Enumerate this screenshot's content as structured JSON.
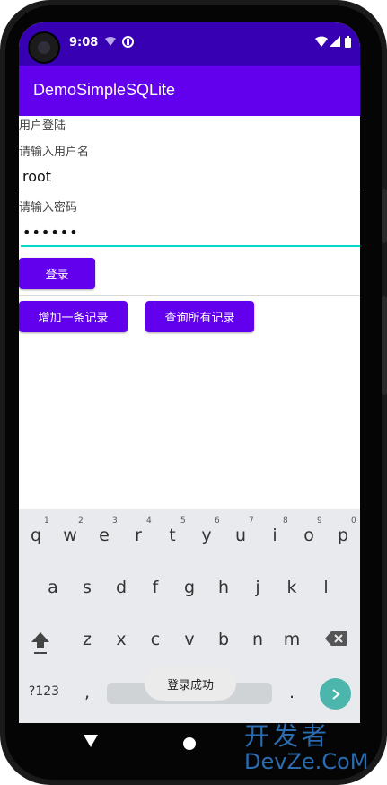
{
  "status_bar": {
    "time": "9:08"
  },
  "app_bar": {
    "title": "DemoSimpleSQLite"
  },
  "login": {
    "header": "用户登陆",
    "username_label": "请输入用户名",
    "username_value": "root",
    "password_label": "请输入密码",
    "password_value": "••••••",
    "login_button": "登录"
  },
  "actions": {
    "add_record": "增加一条记录",
    "query_all": "查询所有记录"
  },
  "keyboard": {
    "row1": [
      "q",
      "w",
      "e",
      "r",
      "t",
      "y",
      "u",
      "i",
      "o",
      "p"
    ],
    "row1_hints": [
      "1",
      "2",
      "3",
      "4",
      "5",
      "6",
      "7",
      "8",
      "9",
      "0"
    ],
    "row2": [
      "a",
      "s",
      "d",
      "f",
      "g",
      "h",
      "j",
      "k",
      "l"
    ],
    "row3": [
      "z",
      "x",
      "c",
      "v",
      "b",
      "n",
      "m"
    ],
    "symbols_key": "?123",
    "comma_key": ",",
    "period_key": "."
  },
  "toast": {
    "message": "登录成功"
  },
  "watermark": {
    "line1": "开发者",
    "line2": "DevZe.CoM"
  },
  "colors": {
    "primary": "#6200ee",
    "primary_dark": "#3700b3",
    "accent": "#03dac5"
  }
}
